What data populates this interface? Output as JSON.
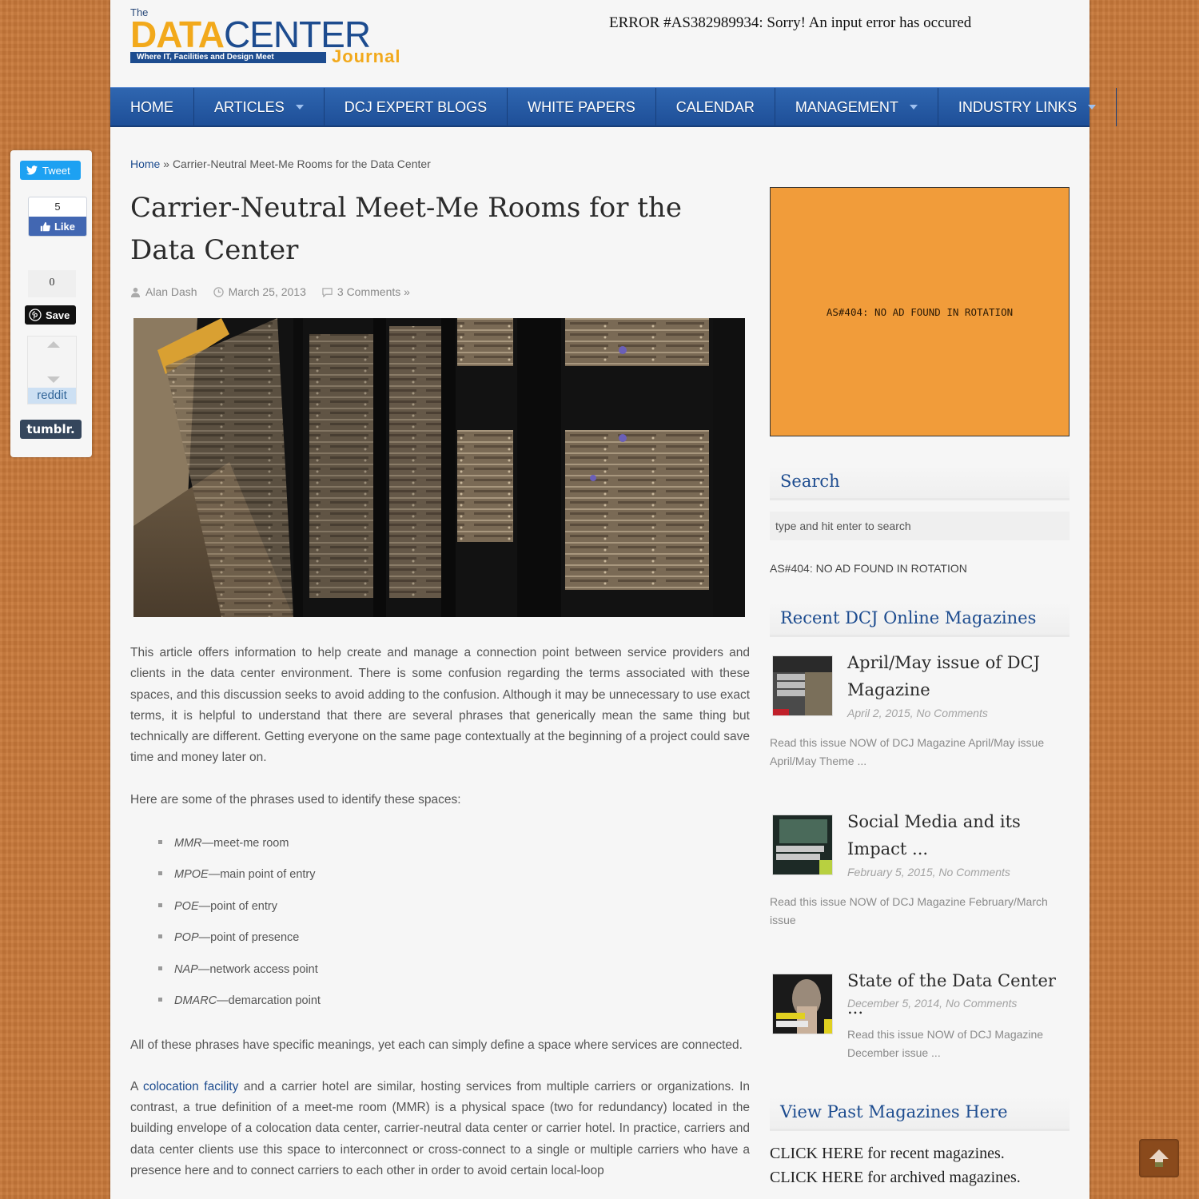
{
  "header": {
    "logo": {
      "the": "The",
      "data": "DATA",
      "center": "CENTER",
      "tagline": "Where IT, Facilities and Design Meet",
      "journal": "Journal"
    },
    "error_message": "ERROR #AS382989934: Sorry! An input error has occured"
  },
  "nav": {
    "items": [
      {
        "label": "HOME",
        "has_dropdown": false
      },
      {
        "label": "ARTICLES",
        "has_dropdown": true
      },
      {
        "label": "DCJ EXPERT BLOGS",
        "has_dropdown": false
      },
      {
        "label": "WHITE PAPERS",
        "has_dropdown": false
      },
      {
        "label": "CALENDAR",
        "has_dropdown": false
      },
      {
        "label": "MANAGEMENT",
        "has_dropdown": true
      },
      {
        "label": "INDUSTRY LINKS",
        "has_dropdown": true
      }
    ]
  },
  "share": {
    "tweet_label": "Tweet",
    "facebook_count": "5",
    "facebook_label": "Like",
    "pinterest_count": "0",
    "pinterest_label": "Save",
    "reddit_label": "reddit",
    "tumblr_label": "tumblr."
  },
  "breadcrumb": {
    "home": "Home",
    "separator": "»",
    "current": "Carrier-Neutral Meet-Me Rooms for the Data Center"
  },
  "article": {
    "title": "Carrier-Neutral Meet-Me Rooms for the Data Center",
    "author": "Alan Dash",
    "date": "March 25, 2013",
    "comments": "3 Comments »",
    "intro": "This article offers information to help create and manage a connection point between service providers and clients in the data center environment. There is some confusion regarding the terms associated with these spaces, and this discussion seeks to avoid adding to the confusion. Although it may be unnecessary to use exact terms, it is helpful to understand that there are several phrases that generically mean the same thing but technically are different. Getting everyone on the same page contextually at the beginning of a project could save time and money later on.",
    "phrases_intro": "Here are some of the phrases used to identify these spaces:",
    "phrases": [
      {
        "abbr": "MMR",
        "meaning": "—meet-me room"
      },
      {
        "abbr": "MPOE",
        "meaning": "—main point of entry"
      },
      {
        "abbr": "POE",
        "meaning": "—point of entry"
      },
      {
        "abbr": "POP",
        "meaning": "—point of presence"
      },
      {
        "abbr": "NAP",
        "meaning": "—network access point"
      },
      {
        "abbr": "DMARC",
        "meaning": "—demarcation point"
      }
    ],
    "para2": "All of these phrases have specific meanings, yet each can simply define a space where services are connected.",
    "para3_prefix": "A ",
    "para3_link": "colocation facility",
    "para3_rest": " and a carrier hotel are similar, hosting services from multiple carriers or organizations. In contrast, a true definition of a meet-me room (MMR) is a physical space (two for redundancy) located in the building envelope of a colocation data center, carrier-neutral data center or carrier hotel. In practice, carriers and data center clients use this space to interconnect or cross-connect to a single or multiple carriers who have a presence here and to connect carriers to each other in order to avoid certain local-loop"
  },
  "sidebar": {
    "ad_text": "AS#404: NO AD FOUND IN ROTATION",
    "search_title": "Search",
    "search_placeholder": "type and hit enter to search",
    "side_ad_text": "AS#404: NO AD FOUND IN ROTATION",
    "magazines_title": "Recent DCJ Online Magazines",
    "magazines": [
      {
        "title": "April/May issue of DCJ Magazine",
        "date": "April 2, 2015, No Comments",
        "desc": "Read this issue NOW of DCJ Magazine April/May issue  April/May Theme ..."
      },
      {
        "title": "Social Media and its Impact ...",
        "date": "February 5, 2015, No Comments",
        "desc": "Read this issue NOW of DCJ Magazine February/March issue"
      },
      {
        "title": "State of the Data Center ...",
        "date": "December 5, 2014, No Comments",
        "desc": "Read this issue NOW of DCJ Magazine December issue    ..."
      }
    ],
    "past_title": "View Past Magazines Here",
    "past_links": [
      "CLICK HERE for recent magazines.",
      "CLICK HERE for archived magazines."
    ]
  },
  "colors": {
    "brand_blue": "#1d4c8f",
    "brand_orange": "#f2a91b",
    "ad_orange": "#f19c3a",
    "background": "#c8793a"
  }
}
